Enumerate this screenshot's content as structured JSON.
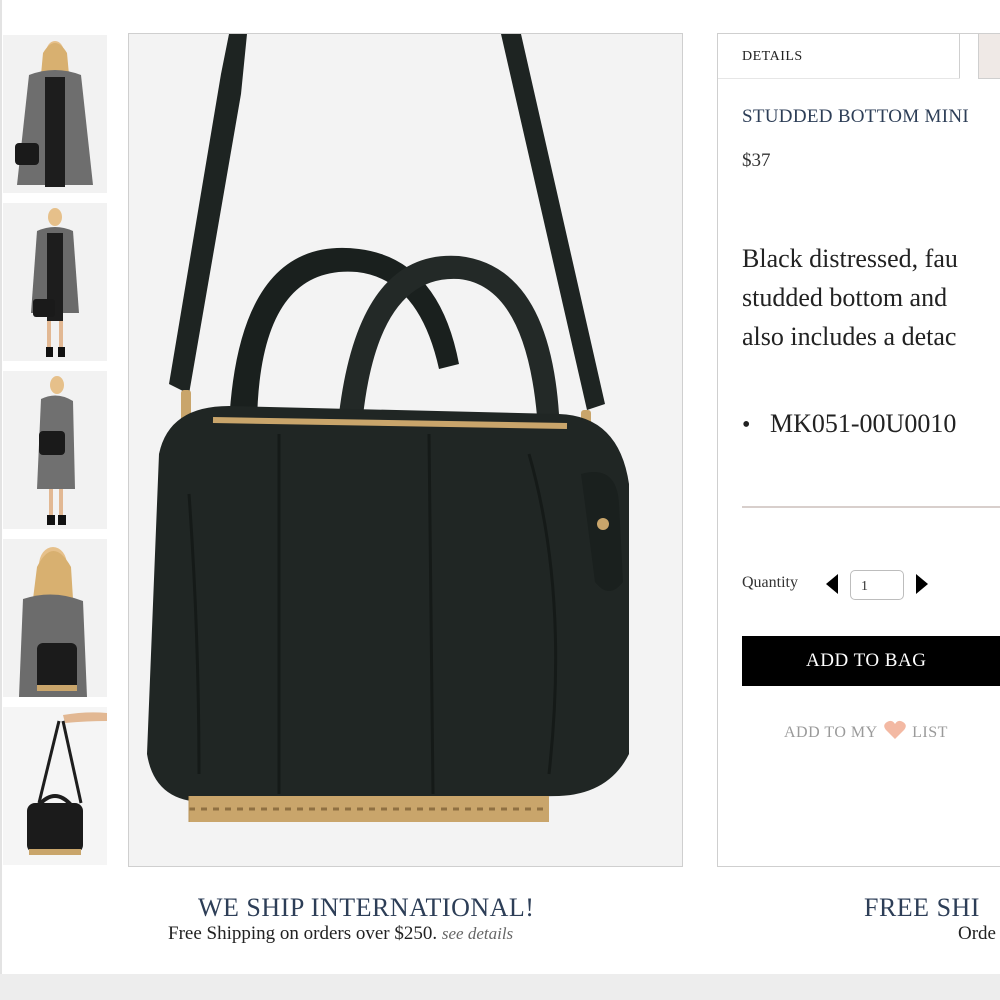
{
  "thumbnails": [
    {
      "name": "model-front-holding-bag"
    },
    {
      "name": "model-full-length-bag"
    },
    {
      "name": "model-side-bag"
    },
    {
      "name": "model-closeup-bag"
    },
    {
      "name": "bag-held-by-strap"
    }
  ],
  "main_image": {
    "subject": "black-studded-bottom-handbag"
  },
  "details": {
    "tab_label": "DETAILS",
    "title": "STUDDED BOTTOM MINI",
    "price": "$37",
    "description_lines": [
      "Black distressed, fau",
      "studded bottom and",
      "also includes a detac"
    ],
    "sku": "MK051-00U0010",
    "quantity_label": "Quantity",
    "quantity_value": "1",
    "add_to_bag_label": "ADD TO BAG",
    "wishlist_prefix": "ADD TO MY",
    "wishlist_suffix": "LIST"
  },
  "promos": {
    "left_title": "WE SHIP INTERNATIONAL!",
    "left_sub": "Free Shipping on orders over $250.",
    "left_link": "see details",
    "right_title": "FREE SHI",
    "right_sub": "Orde"
  },
  "colors": {
    "title_blue": "#2d3e57",
    "button_black": "#000000",
    "heart": "#f3b9a3"
  }
}
